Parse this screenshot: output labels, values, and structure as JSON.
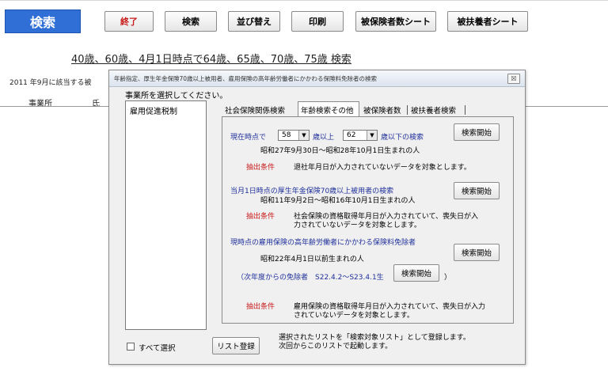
{
  "toolbar": {
    "search_tab": "検索",
    "buttons": [
      "終了",
      "検索",
      "並び替え",
      "印刷",
      "被保険者数シート",
      "被扶養者シート"
    ]
  },
  "age_links": "40歳、60歳、4月1日時点で64歳、65歳、70歳、75歳 検索",
  "background": {
    "note": "2011 年9月に該当する被",
    "headers": [
      "事業所",
      "氏"
    ]
  },
  "dialog": {
    "title": "年齢指定、厚生年金保険70歳以上被用者、雇用保険の高年齢労働者にかかわる保険料免除者の検索",
    "close_label": "☒",
    "prompt": "事業所を選択してください。",
    "list_items": [
      "雇用促進税制"
    ],
    "tabs": [
      "社会保険関係検索",
      "年齢検索その他",
      "被保険者数",
      "被扶養者検索"
    ],
    "sec1": {
      "prefix": "現在時点で",
      "from_value": "58",
      "mid": "歳以上",
      "to_value": "62",
      "suffix": "歳以下の検索",
      "dates": "昭和27年9月30日～昭和28年10月1日生まれの人",
      "cond_label": "抽出条件",
      "cond_text": "退社年月日が入力されていないデータを対象とします。",
      "button": "検索開始"
    },
    "sec2": {
      "title": "当月1日時点の厚生年金保険70歳以上被用者の検索",
      "dates": "昭和11年9月2日～昭和16年10月1日生まれの人",
      "cond_label": "抽出条件",
      "cond_line1": "社会保険の資格取得年月日が入力されていて、喪失日が入",
      "cond_line2": "力されていないデータを対象とします。",
      "button": "検索開始"
    },
    "sec3": {
      "title": "現時点の雇用保険の高年齢労働者にかかわる保険料免除者",
      "dates": "昭和22年4月1日以前生まれの人",
      "next_year": "（次年度からの免除者　S22.4.2～S23.4.1生",
      "close_paren": "）",
      "button_main": "検索開始",
      "button_next": "検索開始",
      "cond_label": "抽出条件",
      "cond_line1": "雇用保険の資格取得年月日が入力されていて、喪失日が入力",
      "cond_line2": "されていないデータを対象とします。"
    },
    "select_all": "すべて選択",
    "register_button": "リスト登録",
    "register_note_line1": "選択されたリストを「検索対象リスト」として登録します。",
    "register_note_line2": "次回からこのリストで起動します。"
  }
}
